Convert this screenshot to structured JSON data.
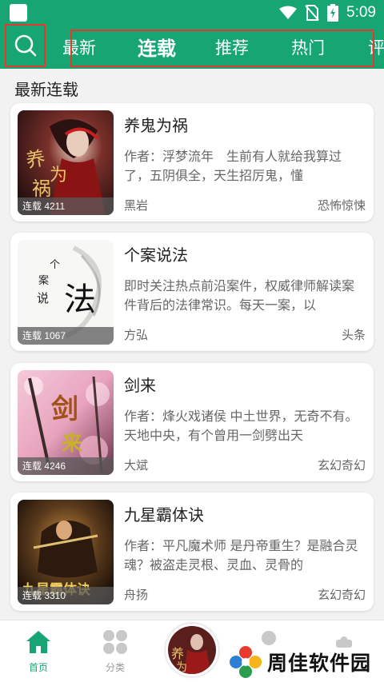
{
  "status_bar": {
    "time": "5:09"
  },
  "tabs": [
    {
      "label": "最新"
    },
    {
      "label": "连载"
    },
    {
      "label": "推荐"
    },
    {
      "label": "热门"
    },
    {
      "label": "评"
    }
  ],
  "active_tab": "连载",
  "section_title": "最新连载",
  "books": [
    {
      "title": "养鬼为祸",
      "desc": "作者：浮梦流年　生前有人就给我算过了，五阴俱全，天生招厉鬼，懂",
      "author": "黑岩",
      "genre": "恐怖惊悚",
      "badge": "连载 4211",
      "cover_text": "养鬼为祸"
    },
    {
      "title": "个案说法",
      "desc": "即时关注热点前沿案件，权威律师解读案件背后的法律常识。每天一案，以",
      "author": "方弘",
      "genre": "头条",
      "badge": "连载 1067",
      "cover_text": "法",
      "cover_small": "个案说"
    },
    {
      "title": "剑来",
      "desc": "作者：烽火戏诸侯 中土世界，无奇不有。天地中央，有个曾用一剑劈出天",
      "author": "大斌",
      "genre": "玄幻奇幻",
      "badge": "连载 4246",
      "cover_text": "剑来"
    },
    {
      "title": "九星霸体诀",
      "desc": "作者：平凡魔术师 是丹帝重生？是融合灵魂？被盗走灵根、灵血、灵骨的",
      "author": "舟扬",
      "genre": "玄幻奇幻",
      "badge": "连载 3310",
      "cover_text": "九星霸体诀"
    }
  ],
  "bottom_nav": [
    {
      "label": "首页",
      "icon": "home-icon"
    },
    {
      "label": "分类",
      "icon": "category-icon"
    },
    {
      "label": "",
      "icon": "current-book"
    },
    {
      "label": "",
      "icon": "user-icon"
    },
    {
      "label": "",
      "icon": "gear-icon"
    }
  ],
  "watermark": "周佳软件园",
  "colors": {
    "accent": "#17a673",
    "highlight_box": "#e23b2e"
  }
}
